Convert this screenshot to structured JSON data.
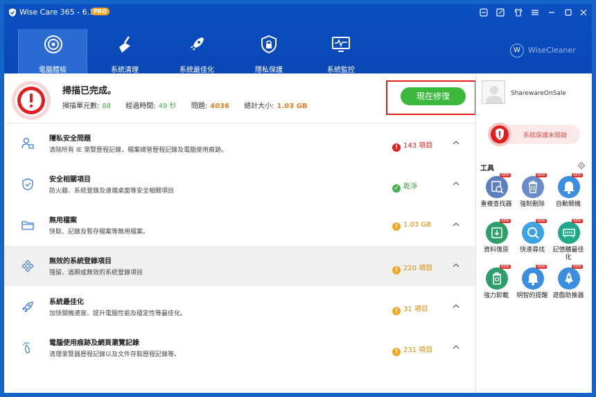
{
  "titlebar": {
    "title": "Wise Care 365 - 6.3.2",
    "badge": "PRO"
  },
  "tabs": [
    {
      "label": "電腦體檢",
      "icon": "target-icon",
      "active": true
    },
    {
      "label": "系統清理",
      "icon": "broom-icon",
      "active": false
    },
    {
      "label": "系統最佳化",
      "icon": "rocket-icon",
      "active": false
    },
    {
      "label": "隱私保護",
      "icon": "lock-shield-icon",
      "active": false
    },
    {
      "label": "系統監控",
      "icon": "monitor-pulse-icon",
      "active": false
    }
  ],
  "brand": {
    "circle": "W",
    "text": "WiseCleaner"
  },
  "scan": {
    "title": "掃描已完成。",
    "units_label": "掃描單元數:",
    "units_value": "88",
    "time_label": "經過時間:",
    "time_value": "49 秒",
    "issues_label": "問題:",
    "issues_value": "4036",
    "size_label": "總計大小:",
    "size_value": "1.03 GB",
    "fix_button": "現在修復"
  },
  "rows": [
    {
      "title": "隱私安全問題",
      "desc": "清除所有 IE 瀏覽歷程記錄，檔案總管歷程記錄及電腦使用痕跡。",
      "status": "143 項目",
      "status_type": "error",
      "icon": "user-privacy-icon"
    },
    {
      "title": "安全相關項目",
      "desc": "防火牆、系統登錄及遠端桌面等安全相關項目",
      "status": "乾淨",
      "status_type": "ok",
      "icon": "shield-check-icon"
    },
    {
      "title": "無用檔案",
      "desc": "快取、記錄及暫存檔案等無用檔案。",
      "status": "1.03 GB",
      "status_type": "warn",
      "icon": "folder-icon"
    },
    {
      "title": "無效的系統登錄項目",
      "desc": "殘留、過期或無效的系統登錄項目",
      "status": "220 項目",
      "status_type": "warn",
      "icon": "registry-icon"
    },
    {
      "title": "系統最佳化",
      "desc": "加快開機速度、提升電腦性能及穩定性等最佳化。",
      "status": "31 項目",
      "status_type": "warn",
      "icon": "rocket-small-icon"
    },
    {
      "title": "電腦使用痕跡及網頁瀏覽記錄",
      "desc": "清理瀏覽器歷程記錄以及文件存取歷程記錄等。",
      "status": "231 項目",
      "status_type": "warn",
      "icon": "footprint-icon"
    }
  ],
  "sidebar": {
    "username": "SharewareOnSale",
    "protect_text": "系統保護未開啟",
    "tools_heading": "工具",
    "new_badge": "NEW",
    "tools": [
      {
        "label": "重複查找器",
        "color": "#5b7fbf",
        "icon": "duplicate-finder-icon"
      },
      {
        "label": "強制刪除",
        "color": "#6b8cc9",
        "icon": "trash-icon"
      },
      {
        "label": "自動關機",
        "color": "#3b8de0",
        "icon": "bell-icon"
      },
      {
        "label": "資料復原",
        "color": "#2e9e6a",
        "icon": "data-recovery-icon"
      },
      {
        "label": "快速尋找",
        "color": "#3aa3e0",
        "icon": "search-icon"
      },
      {
        "label": "記憶體最佳化",
        "color": "#1fa88a",
        "icon": "memory-icon"
      },
      {
        "label": "強力卸載",
        "color": "#2e9e6a",
        "icon": "uninstall-icon"
      },
      {
        "label": "明智的提醒",
        "color": "#3b8de0",
        "icon": "reminder-bell-icon"
      },
      {
        "label": "遊戲助推器",
        "color": "#3b8de0",
        "icon": "game-booster-icon"
      }
    ]
  },
  "colors": {
    "header": "#0b4fc2",
    "fix": "#3cb83c",
    "error": "#e02020",
    "warn": "#f5a623",
    "ok": "#4caf50"
  }
}
